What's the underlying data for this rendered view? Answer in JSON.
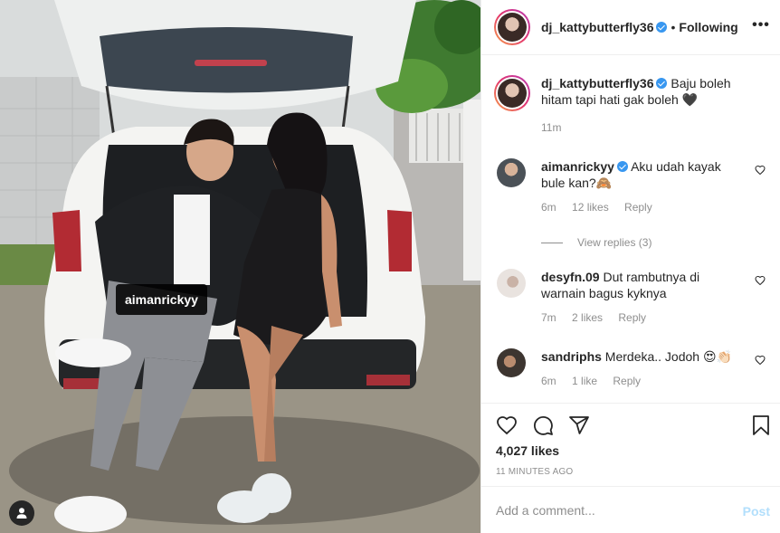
{
  "post": {
    "tag_label": "aimanrickyy"
  },
  "header": {
    "username": "dj_kattybutterfly36",
    "dot": "•",
    "follow_status": "Following",
    "more": "•••"
  },
  "caption": {
    "username": "dj_kattybutterfly36",
    "text": "Baju boleh hitam tapi hati gak boleh 🖤",
    "time": "11m"
  },
  "comments": [
    {
      "username": "aimanrickyy",
      "verified": true,
      "text": "Aku udah kayak bule kan?🙈",
      "time": "6m",
      "likes": "12 likes",
      "reply": "Reply",
      "view_replies": "View replies (3)"
    },
    {
      "username": "desyfn.09",
      "verified": false,
      "text": "Dut rambutnya di warnain bagus kyknya",
      "time": "7m",
      "likes": "2 likes",
      "reply": "Reply"
    },
    {
      "username": "sandriphs",
      "verified": false,
      "text": "Merdeka.. Jodoh 😍👏🏻",
      "time": "6m",
      "likes": "1 like",
      "reply": "Reply"
    }
  ],
  "actions": {
    "likes": "4,027 likes",
    "time_ago": "11 MINUTES AGO"
  },
  "composer": {
    "placeholder": "Add a comment...",
    "post_label": "Post"
  }
}
